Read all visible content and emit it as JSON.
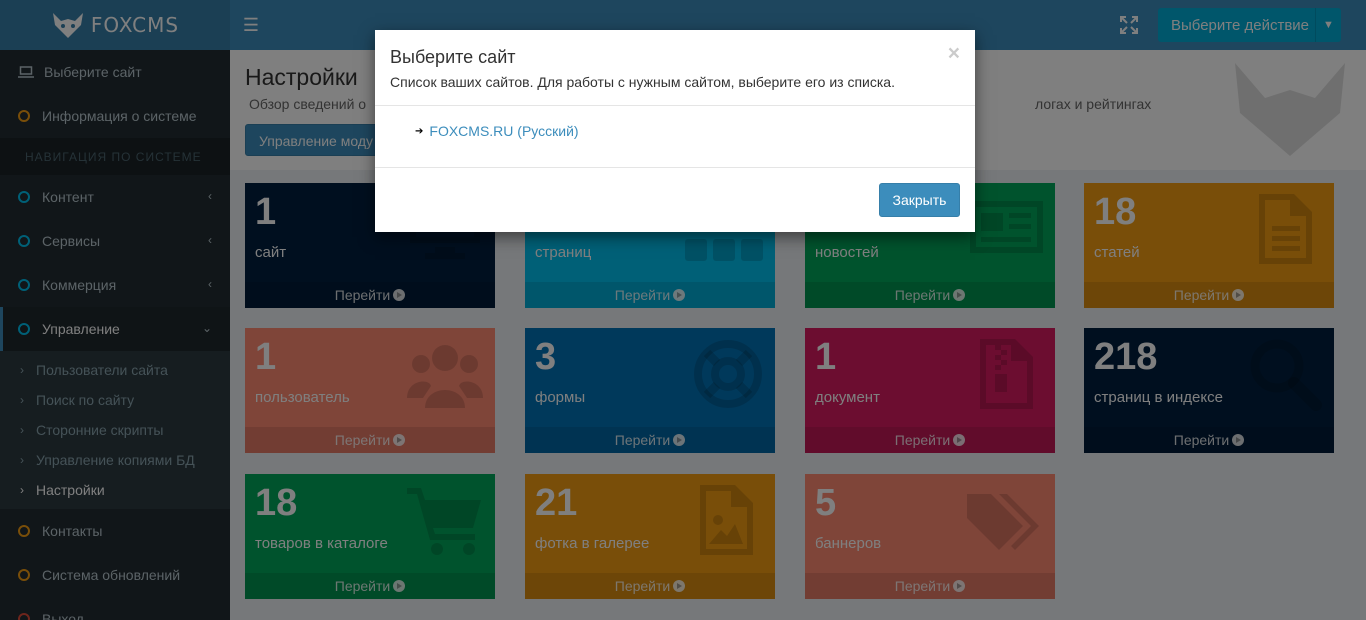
{
  "header": {
    "logo_text": "FOXCMS",
    "action_label": "Выберите действие"
  },
  "sidebar": {
    "top_items": [
      {
        "label": "Выберите сайт"
      },
      {
        "label": "Информация о системе",
        "dot_color": "#f39c12"
      }
    ],
    "section_header": "НАВИГАЦИЯ ПО СИСТЕМЕ",
    "nav_items": [
      {
        "label": "Контент",
        "dot_color": "#00c0ef"
      },
      {
        "label": "Сервисы",
        "dot_color": "#00c0ef"
      },
      {
        "label": "Коммерция",
        "dot_color": "#00c0ef"
      },
      {
        "label": "Управление",
        "dot_color": "#00c0ef"
      }
    ],
    "sub_items": [
      {
        "label": "Пользователи сайта"
      },
      {
        "label": "Поиск по сайту"
      },
      {
        "label": "Сторонние скрипты"
      },
      {
        "label": "Управление копиями БД"
      },
      {
        "label": "Настройки"
      }
    ],
    "bottom_items": [
      {
        "label": "Контакты",
        "dot_color": "#f39c12"
      },
      {
        "label": "Система обновлений",
        "dot_color": "#f39c12"
      },
      {
        "label": "Выход",
        "dot_color": "#dd4b39"
      }
    ]
  },
  "content": {
    "title": "Настройки",
    "subtitle": "Обзор сведений о",
    "subtitle_right": "логах и рейтингах",
    "mgmt_button": "Управление моду"
  },
  "tiles": [
    {
      "value": "1",
      "label": "сайт",
      "link": "Перейти",
      "color": "#001f3f",
      "icon": "monitor-icon"
    },
    {
      "value": "",
      "label": "страниц",
      "link": "Перейти",
      "color": "#00c0ef",
      "icon": "blocks-icon"
    },
    {
      "value": "",
      "label": "новостей",
      "link": "Перейти",
      "color": "#00a65a",
      "icon": "newspaper-icon"
    },
    {
      "value": "18",
      "label": "статей",
      "link": "Перейти",
      "color": "#f39c12",
      "icon": "document-icon"
    },
    {
      "value": "1",
      "label": "пользователь",
      "link": "Перейти",
      "color": "#ff8a73",
      "icon": "users-icon"
    },
    {
      "value": "3",
      "label": "формы",
      "link": "Перейти",
      "color": "#0073b7",
      "icon": "lifebuoy-icon"
    },
    {
      "value": "1",
      "label": "документ",
      "link": "Перейти",
      "color": "#d81b60",
      "icon": "zip-file-icon"
    },
    {
      "value": "218",
      "label": "страниц в индексе",
      "link": "Перейти",
      "color": "#001f3f",
      "icon": "search-icon"
    },
    {
      "value": "18",
      "label": "товаров в каталоге",
      "link": "Перейти",
      "color": "#00a65a",
      "icon": "cart-icon"
    },
    {
      "value": "21",
      "label": "фотка в галерее",
      "link": "Перейти",
      "color": "#f39c12",
      "icon": "image-file-icon"
    },
    {
      "value": "5",
      "label": "баннеров",
      "link": "Перейти",
      "color": "#ff8a73",
      "icon": "tags-icon"
    }
  ],
  "modal": {
    "title": "Выберите сайт",
    "description": "Список ваших сайтов. Для работы с нужным сайтом, выберите его из списка.",
    "close_symbol": "×",
    "sites": [
      {
        "label": "FOXCMS.RU (Русский)"
      }
    ],
    "close_button": "Закрыть"
  }
}
